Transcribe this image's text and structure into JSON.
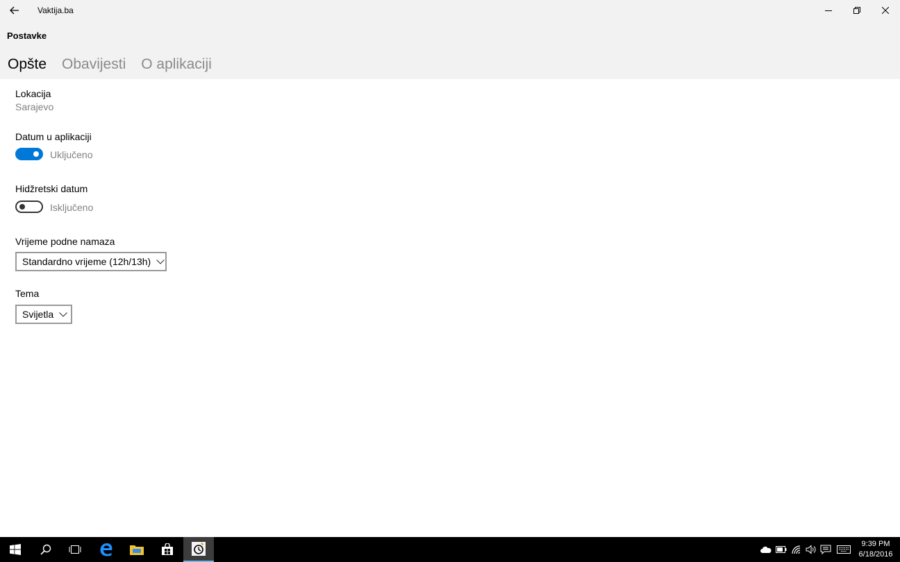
{
  "window": {
    "title": "Vaktija.ba"
  },
  "page": {
    "title": "Postavke"
  },
  "tabs": [
    {
      "label": "Opšte",
      "active": true
    },
    {
      "label": "Obavijesti",
      "active": false
    },
    {
      "label": "O aplikaciji",
      "active": false
    }
  ],
  "settings": {
    "location": {
      "label": "Lokacija",
      "value": "Sarajevo"
    },
    "date_in_app": {
      "label": "Datum u aplikaciji",
      "state": "Uključeno",
      "on": true
    },
    "hijri_date": {
      "label": "Hidžretski datum",
      "state": "Isključeno",
      "on": false
    },
    "noon_prayer": {
      "label": "Vrijeme podne namaza",
      "selected": "Standardno vrijeme (12h/13h)"
    },
    "theme": {
      "label": "Tema",
      "selected": "Svijetla"
    }
  },
  "colors": {
    "accent": "#0078d7",
    "chrome": "#f2f2f2",
    "taskbar": "#000000"
  },
  "taskbar": {
    "apps": [
      "start-icon",
      "search-icon",
      "task-view-icon",
      "edge-icon",
      "file-explorer-icon",
      "store-icon",
      "vaktija-app-icon"
    ],
    "tray": [
      "onedrive-icon",
      "battery-icon",
      "wifi-icon",
      "volume-icon",
      "action-center-icon",
      "keyboard-icon"
    ],
    "time": "9:39 PM",
    "date": "6/18/2016"
  }
}
